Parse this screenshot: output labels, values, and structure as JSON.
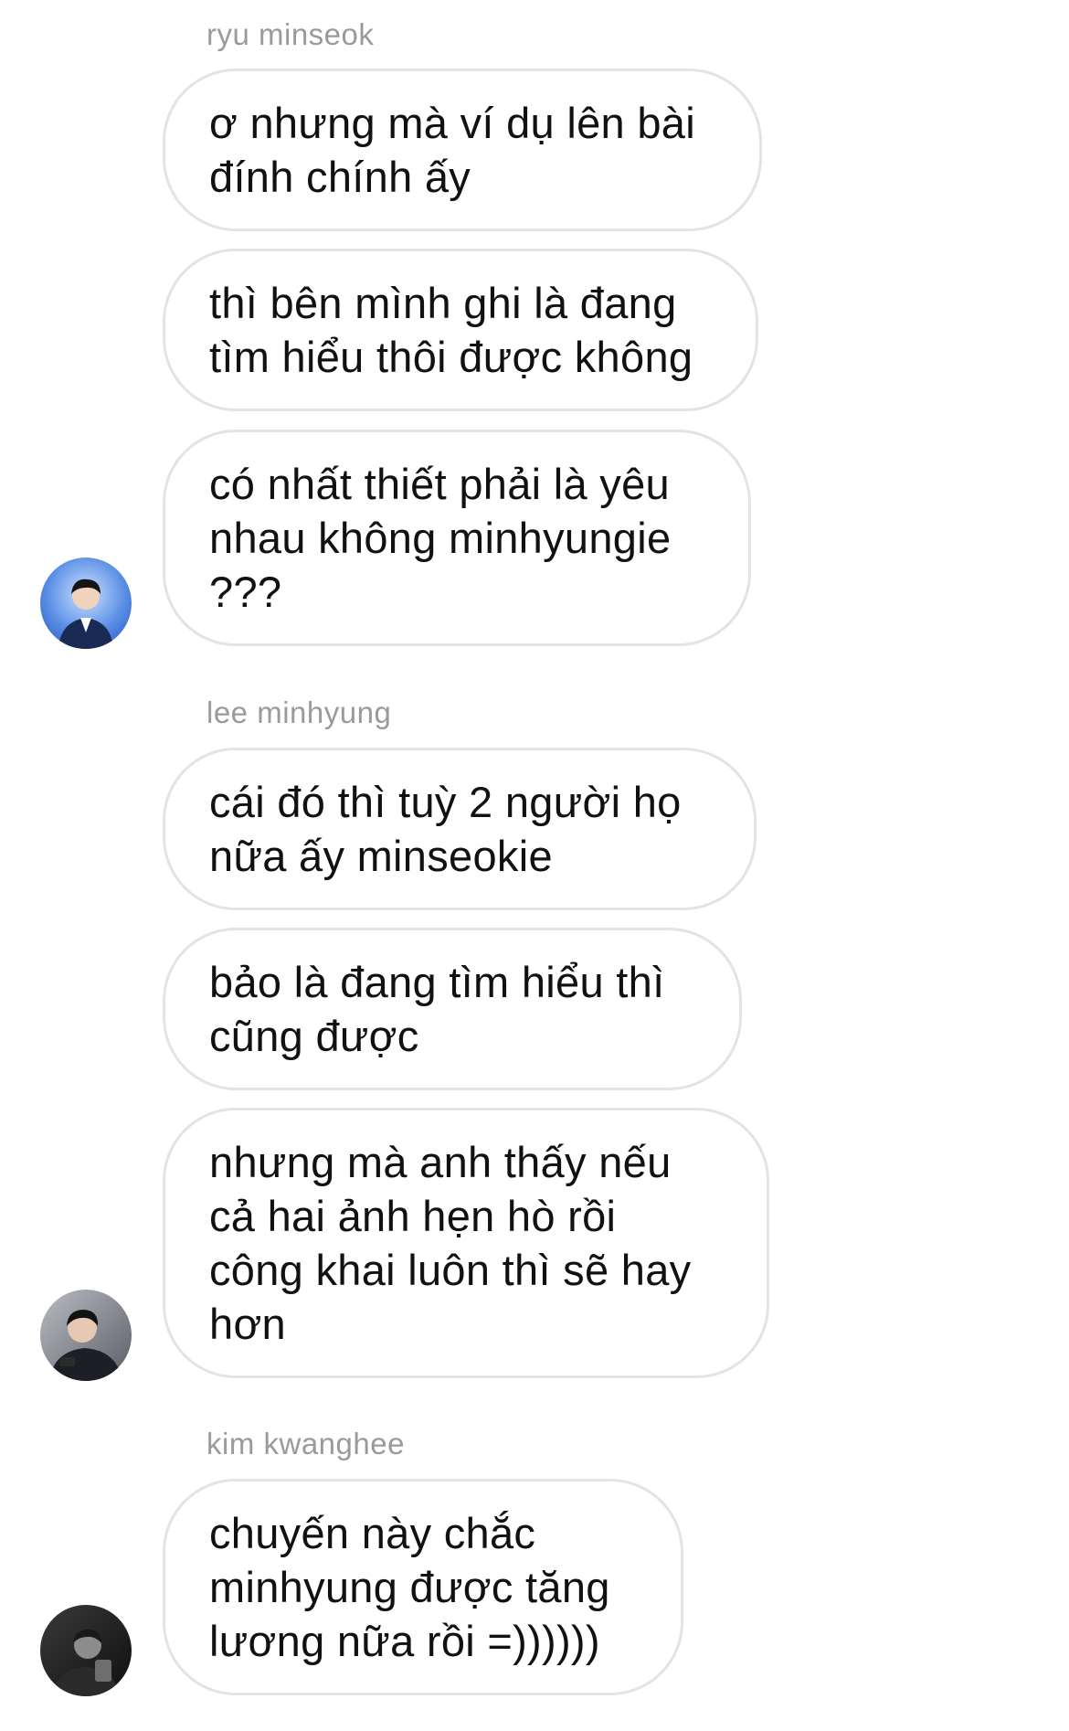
{
  "chat": {
    "groups": [
      {
        "sender": "ryu minseok",
        "avatar_icon": "user-avatar-icon",
        "messages": [
          "ơ nhưng mà ví dụ lên bài đính chính ấy",
          "thì bên mình ghi là đang tìm hiểu thôi được không",
          "có nhất thiết phải là yêu nhau không minhyungie ???"
        ]
      },
      {
        "sender": "lee minhyung",
        "avatar_icon": "user-avatar-icon",
        "messages": [
          "cái đó thì tuỳ 2 người họ nữa ấy minseokie",
          "bảo là đang tìm hiểu thì cũng được",
          "nhưng mà anh thấy nếu cả hai ảnh hẹn hò rồi công khai luôn thì sẽ hay hơn"
        ]
      },
      {
        "sender": "kim kwanghee",
        "avatar_icon": "user-avatar-icon",
        "messages": [
          "chuyến này chắc minhyung được tăng lương nữa rồi =))))))"
        ]
      }
    ]
  },
  "colors": {
    "bubble_border": "#e3e3e3",
    "sender_text": "#9a9a9a",
    "message_text": "#111111",
    "background": "#ffffff"
  }
}
